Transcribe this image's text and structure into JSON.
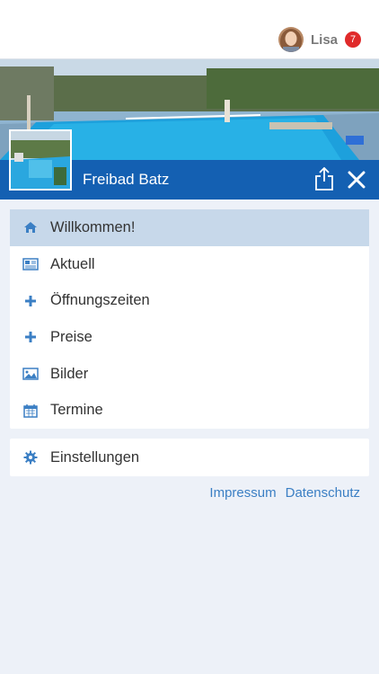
{
  "header": {
    "user_name": "Lisa",
    "notification_count": "7"
  },
  "venue": {
    "title": "Freibad Batz"
  },
  "menu": {
    "items": [
      {
        "label": "Willkommen!",
        "icon": "home-icon",
        "active": true
      },
      {
        "label": "Aktuell",
        "icon": "newspaper-icon",
        "active": false
      },
      {
        "label": "Öffnungszeiten",
        "icon": "plus-icon",
        "active": false
      },
      {
        "label": "Preise",
        "icon": "plus-icon",
        "active": false
      },
      {
        "label": "Bilder",
        "icon": "image-icon",
        "active": false
      },
      {
        "label": "Termine",
        "icon": "calendar-icon",
        "active": false
      }
    ],
    "settings_label": "Einstellungen",
    "settings_icon": "gear-icon"
  },
  "footer": {
    "impressum": "Impressum",
    "datenschutz": "Datenschutz"
  },
  "colors": {
    "accent_blue": "#1460b2",
    "icon_blue": "#3b7fc4",
    "active_row": "#c7d8ea",
    "background": "#edf1f8",
    "badge_red": "#e02a2a"
  }
}
